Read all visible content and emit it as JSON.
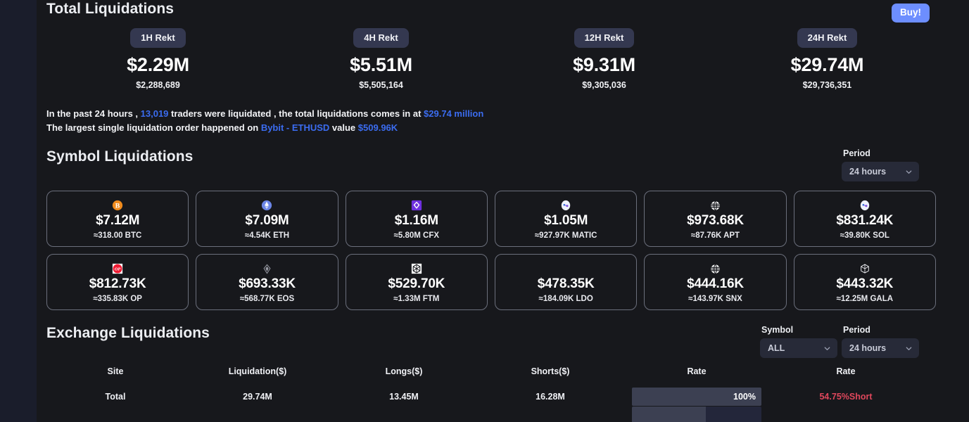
{
  "total": {
    "title": "Total Liquidations",
    "buy_label": "Buy!",
    "accent_color": "#6d8eff",
    "stats": [
      {
        "chip": "1H Rekt",
        "amount": "$2.29M",
        "exact": "$2,288,689"
      },
      {
        "chip": "4H Rekt",
        "amount": "$5.51M",
        "exact": "$5,505,164"
      },
      {
        "chip": "12H Rekt",
        "amount": "$9.31M",
        "exact": "$9,305,036"
      },
      {
        "chip": "24H Rekt",
        "amount": "$29.74M",
        "exact": "$29,736,351"
      }
    ],
    "summary_line1": {
      "a": "In the past 24 hours , ",
      "traders": "13,019",
      "b": " traders were liquidated , the total liquidations comes in at ",
      "amount": "$29.74 million"
    },
    "summary_line2": {
      "a": "The largest single liquidation order happened on ",
      "exchange": "Bybit - ETHUSD",
      "b": " value ",
      "amount": "$509.96K"
    },
    "link_color": "#3b6cf0"
  },
  "symbol": {
    "title": "Symbol Liquidations",
    "period_label": "Period",
    "period_value": "24 hours",
    "cards": [
      {
        "icon": "btc-icon",
        "amount": "$7.12M",
        "qty": "≈318.00 BTC"
      },
      {
        "icon": "eth-icon",
        "amount": "$7.09M",
        "qty": "≈4.54K ETH"
      },
      {
        "icon": "cfx-icon",
        "amount": "$1.16M",
        "qty": "≈5.80M CFX"
      },
      {
        "icon": "matic-icon",
        "amount": "$1.05M",
        "qty": "≈927.97K MATIC"
      },
      {
        "icon": "apt-icon",
        "amount": "$973.68K",
        "qty": "≈87.76K APT"
      },
      {
        "icon": "sol-icon",
        "amount": "$831.24K",
        "qty": "≈39.80K SOL"
      },
      {
        "icon": "op-icon",
        "amount": "$812.73K",
        "qty": "≈335.83K OP"
      },
      {
        "icon": "eos-icon",
        "amount": "$693.33K",
        "qty": "≈568.77K EOS"
      },
      {
        "icon": "ftm-icon",
        "amount": "$529.70K",
        "qty": "≈1.33M FTM"
      },
      {
        "icon": "none",
        "amount": "$478.35K",
        "qty": "≈184.09K LDO"
      },
      {
        "icon": "snx-icon",
        "amount": "$444.16K",
        "qty": "≈143.97K SNX"
      },
      {
        "icon": "gala-icon",
        "amount": "$443.32K",
        "qty": "≈12.25M GALA"
      }
    ]
  },
  "exchange": {
    "title": "Exchange Liquidations",
    "symbol_label": "Symbol",
    "symbol_value": "ALL",
    "period_label": "Period",
    "period_value": "24 hours",
    "columns": [
      "Site",
      "Liquidation($)",
      "Longs($)",
      "Shorts($)",
      "Rate",
      "Rate"
    ],
    "rows": [
      {
        "site": "Total",
        "liquidation": "29.74M",
        "longs": "13.45M",
        "shorts": "16.28M",
        "rate_pct": "100%",
        "rate_fill": 100,
        "ratio": "54.75%Short",
        "ratio_color": "#e0475c"
      }
    ],
    "partial_row_fill": 57
  }
}
